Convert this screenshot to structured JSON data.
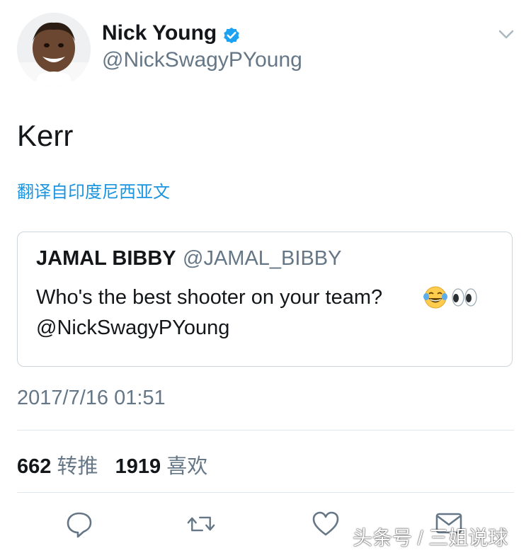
{
  "tweet": {
    "author_name": "Nick Young",
    "author_handle": "@NickSwagyPYoung",
    "text": "Kerr",
    "translate_link": "翻译自印度尼西亚文",
    "timestamp": "2017/7/16 01:51"
  },
  "quoted_tweet": {
    "author_name": "JAMAL BIBBY",
    "author_handle": "@JAMAL_BIBBY",
    "text_line1": "Who's the best shooter on your team?",
    "text_line2": "@NickSwagyPYoung",
    "emojis": [
      "face-with-tears-of-joy",
      "eyes"
    ]
  },
  "stats": {
    "retweets_count": "662",
    "retweets_label": "转推",
    "likes_count": "1919",
    "likes_label": "喜欢"
  },
  "actions": [
    "reply-icon",
    "retweet-icon",
    "like-icon",
    "message-icon"
  ],
  "watermark": "头条号 / 三姐说球",
  "colors": {
    "link": "#1b95e0",
    "secondary_text": "#657786",
    "verified": "#1da1f2",
    "divider": "#e1e8ed"
  }
}
